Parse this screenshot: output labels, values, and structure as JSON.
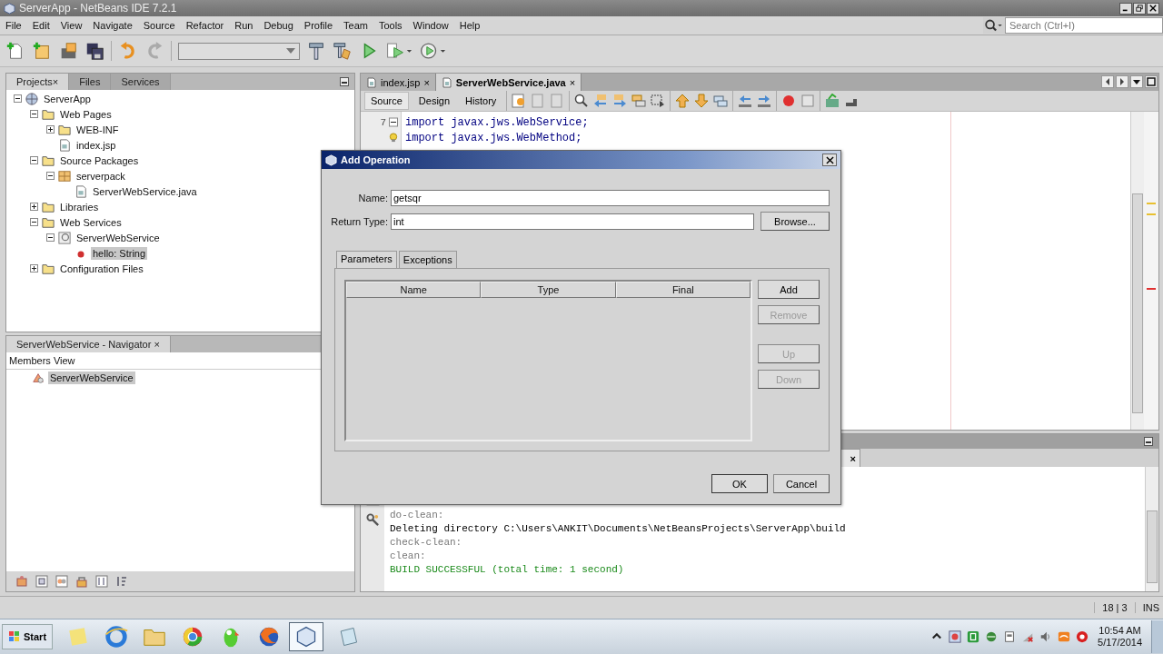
{
  "window": {
    "title": "ServerApp - NetBeans IDE 7.2.1"
  },
  "menu": [
    "File",
    "Edit",
    "View",
    "Navigate",
    "Source",
    "Refactor",
    "Run",
    "Debug",
    "Profile",
    "Team",
    "Tools",
    "Window",
    "Help"
  ],
  "search": {
    "placeholder": "Search (Ctrl+I)"
  },
  "project_tabs": [
    {
      "label": "Projects",
      "selected": true,
      "close": "×"
    },
    {
      "label": "Files",
      "selected": false
    },
    {
      "label": "Services",
      "selected": false
    }
  ],
  "project_tree": [
    {
      "label": "ServerApp",
      "kind": "globe",
      "expanded": true,
      "selected": false,
      "children": [
        {
          "label": "Web Pages",
          "kind": "folder",
          "expanded": true,
          "selected": false,
          "children": [
            {
              "label": "WEB-INF",
              "kind": "folder",
              "expanded": false,
              "selected": false
            },
            {
              "label": "index.jsp",
              "kind": "file",
              "selected": false
            }
          ]
        },
        {
          "label": "Source Packages",
          "kind": "folder",
          "expanded": true,
          "selected": false,
          "children": [
            {
              "label": "serverpack",
              "kind": "package",
              "expanded": true,
              "selected": false,
              "children": [
                {
                  "label": "ServerWebService.java",
                  "kind": "file",
                  "selected": false
                }
              ]
            }
          ]
        },
        {
          "label": "Libraries",
          "kind": "folder",
          "expanded": false,
          "selected": false
        },
        {
          "label": "Web Services",
          "kind": "folder",
          "expanded": true,
          "selected": false,
          "children": [
            {
              "label": "ServerWebService",
              "kind": "service",
              "expanded": true,
              "selected": false,
              "children": [
                {
                  "label": "hello: String",
                  "kind": "method",
                  "selected": true
                }
              ]
            }
          ]
        },
        {
          "label": "Configuration Files",
          "kind": "folder",
          "expanded": false,
          "selected": false
        }
      ]
    }
  ],
  "navigator": {
    "title": "ServerWebService - Navigator",
    "close": "×",
    "view": "Members View",
    "items": [
      {
        "label": "ServerWebService",
        "selected": true
      }
    ]
  },
  "editor_tabs": [
    {
      "label": "index.jsp",
      "selected": false,
      "close": "×"
    },
    {
      "label": "ServerWebService.java",
      "selected": true,
      "close": "×"
    }
  ],
  "editor_views": [
    {
      "label": "Source",
      "selected": true
    },
    {
      "label": "Design",
      "selected": false
    },
    {
      "label": "History",
      "selected": false
    }
  ],
  "code_lines": [
    {
      "number": "7",
      "text": "import javax.jws.WebService;",
      "kind": "fold"
    },
    {
      "text": "import javax.jws.WebMethod;",
      "kind": "hint"
    }
  ],
  "output": {
    "tab_close": "×",
    "lines": [
      {
        "text": "do-clean:",
        "kind": "target"
      },
      {
        "text": "Deleting directory C:\\Users\\ANKIT\\Documents\\NetBeansProjects\\ServerApp\\build",
        "kind": "message"
      },
      {
        "text": "check-clean:",
        "kind": "target"
      },
      {
        "text": "clean:",
        "kind": "target"
      },
      {
        "text": "BUILD SUCCESSFUL (total time: 1 second)",
        "kind": "success"
      }
    ]
  },
  "dialog": {
    "title": "Add Operation",
    "name_label": "Name:",
    "name_value": "getsqr",
    "return_label": "Return Type:",
    "return_value": "int",
    "browse": "Browse...",
    "tabs": [
      {
        "label": "Parameters",
        "selected": true
      },
      {
        "label": "Exceptions",
        "selected": false
      }
    ],
    "columns": [
      "Name",
      "Type",
      "Final"
    ],
    "side_buttons": [
      {
        "label": "Add",
        "disabled": false
      },
      {
        "label": "Remove",
        "disabled": true
      },
      {
        "label": "Up",
        "disabled": true
      },
      {
        "label": "Down",
        "disabled": true
      }
    ],
    "buttons": [
      "OK",
      "Cancel"
    ]
  },
  "status": {
    "position": "18 | 3",
    "mode": "INS"
  },
  "taskbar": {
    "start": "Start",
    "time": "10:54 AM",
    "date": "5/17/2014"
  }
}
